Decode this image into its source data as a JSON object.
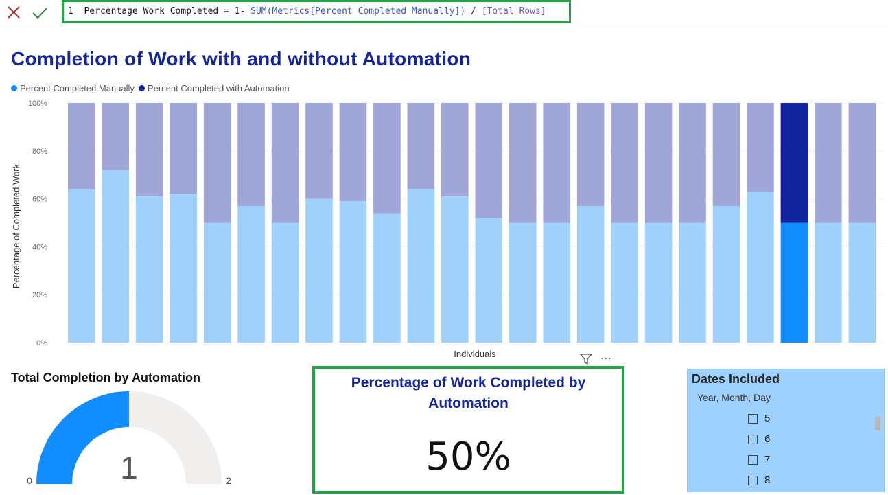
{
  "formula_bar": {
    "line_number": "1",
    "measure_name": "Percentage Work Completed = 1- ",
    "func_part": "SUM(Metrics[Percent Completed Manually])",
    "op_part": " / ",
    "ref_part": "[Total Rows]"
  },
  "report": {
    "title": "Completion of Work with and without Automation",
    "legend": [
      {
        "label": "Percent Completed Manually",
        "color": "#118dff"
      },
      {
        "label": "Percent Completed with Automation",
        "color": "#12239e"
      }
    ]
  },
  "chart_data": {
    "type": "bar",
    "stacked": true,
    "percent_stacked": true,
    "xlabel": "Individuals",
    "ylabel": "Percentage of Completed Work",
    "yticks": [
      "0%",
      "20%",
      "40%",
      "60%",
      "80%",
      "100%"
    ],
    "ylim": [
      0,
      100
    ],
    "series": [
      {
        "name": "Percent Completed Manually",
        "values": [
          64,
          72,
          61,
          62,
          50,
          57,
          50,
          60,
          59,
          54,
          64,
          61,
          52,
          50,
          50,
          57,
          50,
          50,
          50,
          57,
          63,
          50,
          50,
          50
        ]
      },
      {
        "name": "Percent Completed with Automation",
        "values": [
          36,
          28,
          39,
          38,
          50,
          43,
          50,
          40,
          41,
          46,
          36,
          39,
          48,
          50,
          50,
          43,
          50,
          50,
          50,
          43,
          37,
          50,
          50,
          50
        ]
      }
    ],
    "highlighted_index": 21,
    "colors": {
      "manual_dim": "#a0d1fd",
      "auto_dim": "#a0a7d8",
      "manual": "#118dff",
      "auto": "#12239e",
      "grid": "#d6d6d6"
    },
    "grid": true
  },
  "gauge": {
    "title": "Total Completion by Automation",
    "min": "0",
    "max": "2",
    "value": "1",
    "value_num": 1,
    "max_num": 2,
    "fill_color": "#118dff",
    "track_color": "#f0efee"
  },
  "card": {
    "title": "Percentage of Work Completed by Automation",
    "value": "50%"
  },
  "slicer": {
    "title": "Dates Included",
    "subtitle": "Year, Month, Day",
    "items": [
      "5",
      "6",
      "7",
      "8"
    ]
  },
  "icons": [
    "close-icon",
    "checkmark-icon",
    "filter-icon",
    "more-options-icon"
  ]
}
